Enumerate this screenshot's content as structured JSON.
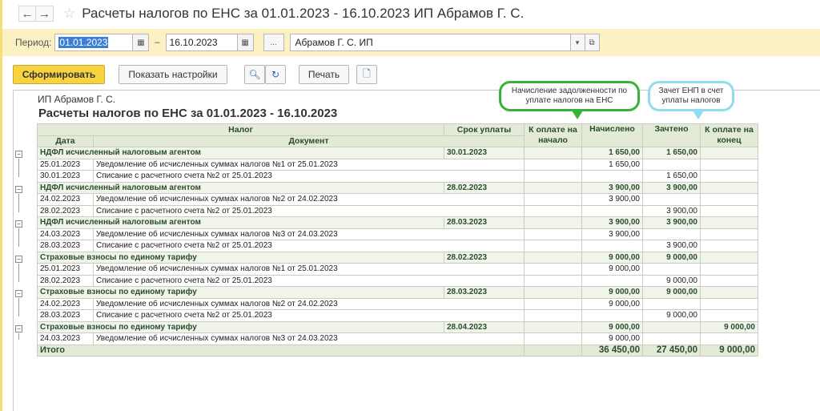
{
  "window": {
    "title": "Расчеты налогов по ЕНС за 01.01.2023 - 16.10.2023 ИП Абрамов Г. С."
  },
  "filters": {
    "period_label": "Период:",
    "date_from": "01.01.2023",
    "date_to": "16.10.2023",
    "dash": "–",
    "dots": "...",
    "organization": "Абрамов Г. С. ИП"
  },
  "toolbar": {
    "generate_label": "Сформировать",
    "settings_label": "Показать настройки",
    "print_label": "Печать"
  },
  "report": {
    "org_name": "ИП Абрамов Г. С.",
    "title": "Расчеты налогов по ЕНС за 01.01.2023 - 16.10.2023",
    "callout_accrual": "Начисление задолженности по уплате налогов на ЕНС",
    "callout_offset": "Зачет ЕНП в счет уплаты налогов",
    "headers": {
      "tax": "Налог",
      "due": "Срок уплаты",
      "opening": "К оплате на начало",
      "accrued": "Начислено",
      "credited": "Зачтено",
      "closing": "К оплате на конец",
      "date": "Дата",
      "document": "Документ"
    },
    "groups": [
      {
        "tax": "НДФЛ исчисленный налоговым агентом",
        "due": "30.01.2023",
        "opening": "",
        "accrued": "1 650,00",
        "credited": "1 650,00",
        "closing": "",
        "rows": [
          {
            "date": "25.01.2023",
            "doc": "Уведомление об исчисленных суммах налогов №1 от 25.01.2023",
            "accrued": "1 650,00",
            "credited": ""
          },
          {
            "date": "30.01.2023",
            "doc": "Списание с расчетного счета №2 от 25.01.2023",
            "accrued": "",
            "credited": "1 650,00"
          }
        ]
      },
      {
        "tax": "НДФЛ исчисленный налоговым агентом",
        "due": "28.02.2023",
        "opening": "",
        "accrued": "3 900,00",
        "credited": "3 900,00",
        "closing": "",
        "rows": [
          {
            "date": "24.02.2023",
            "doc": "Уведомление об исчисленных суммах налогов №2 от 24.02.2023",
            "accrued": "3 900,00",
            "credited": ""
          },
          {
            "date": "28.02.2023",
            "doc": "Списание с расчетного счета №2 от 25.01.2023",
            "accrued": "",
            "credited": "3 900,00"
          }
        ]
      },
      {
        "tax": "НДФЛ исчисленный налоговым агентом",
        "due": "28.03.2023",
        "opening": "",
        "accrued": "3 900,00",
        "credited": "3 900,00",
        "closing": "",
        "rows": [
          {
            "date": "24.03.2023",
            "doc": "Уведомление об исчисленных суммах налогов №3 от 24.03.2023",
            "accrued": "3 900,00",
            "credited": ""
          },
          {
            "date": "28.03.2023",
            "doc": "Списание с расчетного счета №2 от 25.01.2023",
            "accrued": "",
            "credited": "3 900,00"
          }
        ]
      },
      {
        "tax": "Страховые взносы по единому тарифу",
        "due": "28.02.2023",
        "opening": "",
        "accrued": "9 000,00",
        "credited": "9 000,00",
        "closing": "",
        "rows": [
          {
            "date": "25.01.2023",
            "doc": "Уведомление об исчисленных суммах налогов №1 от 25.01.2023",
            "accrued": "9 000,00",
            "credited": ""
          },
          {
            "date": "28.02.2023",
            "doc": "Списание с расчетного счета №2 от 25.01.2023",
            "accrued": "",
            "credited": "9 000,00"
          }
        ]
      },
      {
        "tax": "Страховые взносы по единому тарифу",
        "due": "28.03.2023",
        "opening": "",
        "accrued": "9 000,00",
        "credited": "9 000,00",
        "closing": "",
        "rows": [
          {
            "date": "24.02.2023",
            "doc": "Уведомление об исчисленных суммах налогов №2 от 24.02.2023",
            "accrued": "9 000,00",
            "credited": ""
          },
          {
            "date": "28.03.2023",
            "doc": "Списание с расчетного счета №2 от 25.01.2023",
            "accrued": "",
            "credited": "9 000,00"
          }
        ]
      },
      {
        "tax": "Страховые взносы по единому тарифу",
        "due": "28.04.2023",
        "opening": "",
        "accrued": "9 000,00",
        "credited": "",
        "closing": "9 000,00",
        "rows": [
          {
            "date": "24.03.2023",
            "doc": "Уведомление об исчисленных суммах налогов №3 от 24.03.2023",
            "accrued": "9 000,00",
            "credited": ""
          }
        ]
      }
    ],
    "total": {
      "label": "Итого",
      "accrued": "36 450,00",
      "credited": "27 450,00",
      "closing": "9 000,00"
    }
  }
}
